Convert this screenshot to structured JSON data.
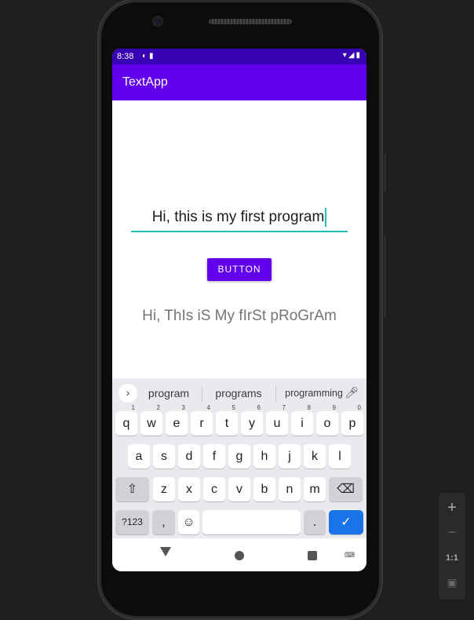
{
  "statusbar": {
    "time": "8:38"
  },
  "app": {
    "title": "TextApp"
  },
  "main": {
    "edit_value": "Hi, this is my first program",
    "button_label": "BUTTON",
    "result_text": "Hi, ThIs iS My fIrSt pRoGrAm"
  },
  "keyboard": {
    "suggestions": [
      "program",
      "programs",
      "programming"
    ],
    "row1": [
      {
        "k": "q",
        "h": "1"
      },
      {
        "k": "w",
        "h": "2"
      },
      {
        "k": "e",
        "h": "3"
      },
      {
        "k": "r",
        "h": "4"
      },
      {
        "k": "t",
        "h": "5"
      },
      {
        "k": "y",
        "h": "6"
      },
      {
        "k": "u",
        "h": "7"
      },
      {
        "k": "i",
        "h": "8"
      },
      {
        "k": "o",
        "h": "9"
      },
      {
        "k": "p",
        "h": "0"
      }
    ],
    "row2": [
      "a",
      "s",
      "d",
      "f",
      "g",
      "h",
      "j",
      "k",
      "l"
    ],
    "row3": [
      "z",
      "x",
      "c",
      "v",
      "b",
      "n",
      "m"
    ],
    "symbols_label": "?123",
    "comma_label": ",",
    "period_label": "."
  },
  "emulator_toolbar": {
    "zoom_in": "+",
    "zoom_out": "−",
    "one_to_one": "1:1"
  },
  "colors": {
    "status": "#3700b3",
    "primary": "#6200ee",
    "accent": "#1fbfb2",
    "done_key": "#1a73e8"
  }
}
